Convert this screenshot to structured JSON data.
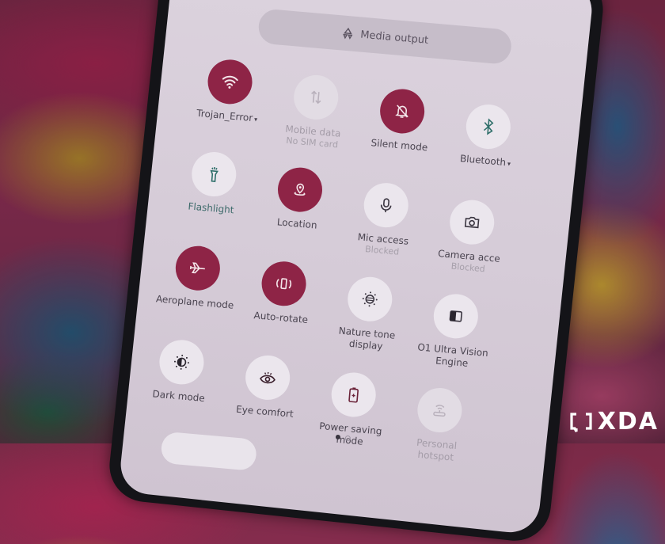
{
  "media_output": {
    "label": "Media output",
    "icon": "media-output-icon"
  },
  "tiles": [
    {
      "id": "wifi",
      "label": "Trojan_Error",
      "has_caret": true,
      "state": "on",
      "icon": "wifi-icon"
    },
    {
      "id": "mobile-data",
      "label": "Mobile data",
      "sublabel": "No SIM card",
      "state": "disabled",
      "icon": "mobile-data-icon"
    },
    {
      "id": "silent-mode",
      "label": "Silent mode",
      "state": "on",
      "icon": "bell-off-icon"
    },
    {
      "id": "bluetooth",
      "label": "Bluetooth",
      "has_caret": true,
      "state": "off",
      "icon": "bluetooth-icon"
    },
    {
      "id": "flashlight",
      "label": "Flashlight",
      "state": "off",
      "icon": "flashlight-icon"
    },
    {
      "id": "location",
      "label": "Location",
      "state": "on",
      "icon": "location-icon"
    },
    {
      "id": "mic-access",
      "label": "Mic access",
      "sublabel": "Blocked",
      "state": "off",
      "icon": "microphone-icon"
    },
    {
      "id": "camera-access",
      "label": "Camera acce",
      "sublabel": "Blocked",
      "state": "off",
      "icon": "camera-icon"
    },
    {
      "id": "aeroplane-mode",
      "label": "Aeroplane mode",
      "state": "on",
      "icon": "airplane-icon"
    },
    {
      "id": "auto-rotate",
      "label": "Auto-rotate",
      "state": "on",
      "icon": "auto-rotate-icon"
    },
    {
      "id": "nature-tone",
      "label": "Nature tone display",
      "state": "off",
      "icon": "nature-tone-icon"
    },
    {
      "id": "o1-ultra",
      "label": "O1 Ultra Vision Engine",
      "state": "off",
      "icon": "vision-engine-icon"
    },
    {
      "id": "dark-mode",
      "label": "Dark mode",
      "state": "off",
      "icon": "dark-mode-icon"
    },
    {
      "id": "eye-comfort",
      "label": "Eye comfort",
      "state": "off",
      "icon": "eye-icon"
    },
    {
      "id": "power-saving",
      "label": "Power saving mode",
      "state": "off",
      "icon": "battery-icon"
    },
    {
      "id": "personal-hotspot",
      "label": "Personal hotspot",
      "state": "disabled",
      "icon": "hotspot-icon"
    }
  ],
  "pagination": {
    "pages": 2,
    "current": 1
  },
  "colors": {
    "accent": "#8e2446",
    "tile_off": "#ebe6ed",
    "text": "#4a4450",
    "text_dim": "#a49ca8",
    "teal_icon": "#2f6f6a"
  },
  "watermark": {
    "text": "XDA"
  }
}
